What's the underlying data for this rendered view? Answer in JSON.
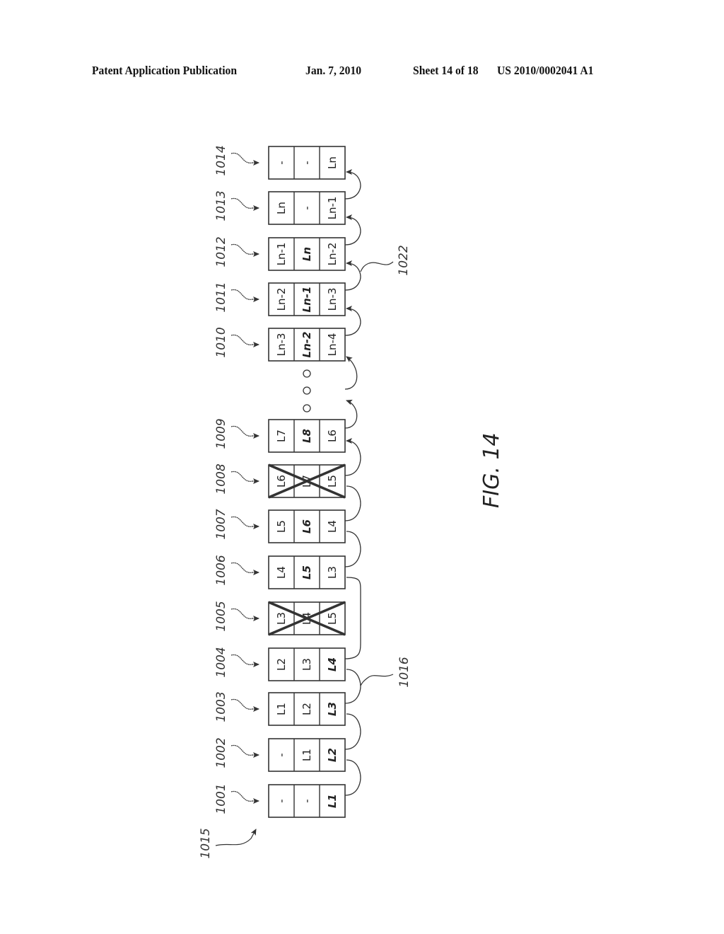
{
  "header": {
    "publication": "Patent Application Publication",
    "date": "Jan. 7, 2010",
    "sheet": "Sheet 14 of 18",
    "number": "US 2010/0002041 A1"
  },
  "figure": {
    "label": "FIG. 14",
    "group_ref": "1015",
    "blocks": [
      {
        "ref": "1001",
        "cells": [
          "-",
          "-",
          "L1"
        ],
        "bold": [
          false,
          false,
          true
        ],
        "crossed": false
      },
      {
        "ref": "1002",
        "cells": [
          "-",
          "L1",
          "L2"
        ],
        "bold": [
          false,
          false,
          true
        ],
        "crossed": false
      },
      {
        "ref": "1003",
        "cells": [
          "L1",
          "L2",
          "L3"
        ],
        "bold": [
          false,
          false,
          true
        ],
        "crossed": false
      },
      {
        "ref": "1004",
        "cells": [
          "L2",
          "L3",
          "L4"
        ],
        "bold": [
          false,
          false,
          true
        ],
        "crossed": false
      },
      {
        "ref": "1005",
        "cells": [
          "L3",
          "L4",
          "L5"
        ],
        "bold": [
          false,
          false,
          false
        ],
        "crossed": true
      },
      {
        "ref": "1006",
        "cells": [
          "L4",
          "L5",
          "L3"
        ],
        "bold": [
          false,
          true,
          false
        ],
        "crossed": false
      },
      {
        "ref": "1007",
        "cells": [
          "L5",
          "L6",
          "L4"
        ],
        "bold": [
          false,
          true,
          false
        ],
        "crossed": false
      },
      {
        "ref": "1008",
        "cells": [
          "L6",
          "L7",
          "L5"
        ],
        "bold": [
          false,
          false,
          false
        ],
        "crossed": true
      },
      {
        "ref": "1009",
        "cells": [
          "L7",
          "L8",
          "L6"
        ],
        "bold": [
          false,
          true,
          false
        ],
        "crossed": false
      },
      {
        "ref": "1010",
        "cells": [
          "Ln-3",
          "Ln-2",
          "Ln-4"
        ],
        "bold": [
          false,
          true,
          false
        ],
        "crossed": false
      },
      {
        "ref": "1011",
        "cells": [
          "Ln-2",
          "Ln-1",
          "Ln-3"
        ],
        "bold": [
          false,
          true,
          false
        ],
        "crossed": false
      },
      {
        "ref": "1012",
        "cells": [
          "Ln-1",
          "Ln",
          "Ln-2"
        ],
        "bold": [
          false,
          true,
          false
        ],
        "crossed": false
      },
      {
        "ref": "1013",
        "cells": [
          "Ln",
          "-",
          "Ln-1"
        ],
        "bold": [
          false,
          false,
          false
        ],
        "crossed": false
      },
      {
        "ref": "1014",
        "cells": [
          "-",
          "-",
          "Ln"
        ],
        "bold": [
          false,
          false,
          false
        ],
        "crossed": false
      }
    ],
    "ellipsis": "o o o",
    "connector_refs": [
      {
        "ref": "1016",
        "note": "connector between 1003 and 1004"
      },
      {
        "ref": "1022",
        "note": "connector between 1011 and 1012"
      }
    ]
  }
}
